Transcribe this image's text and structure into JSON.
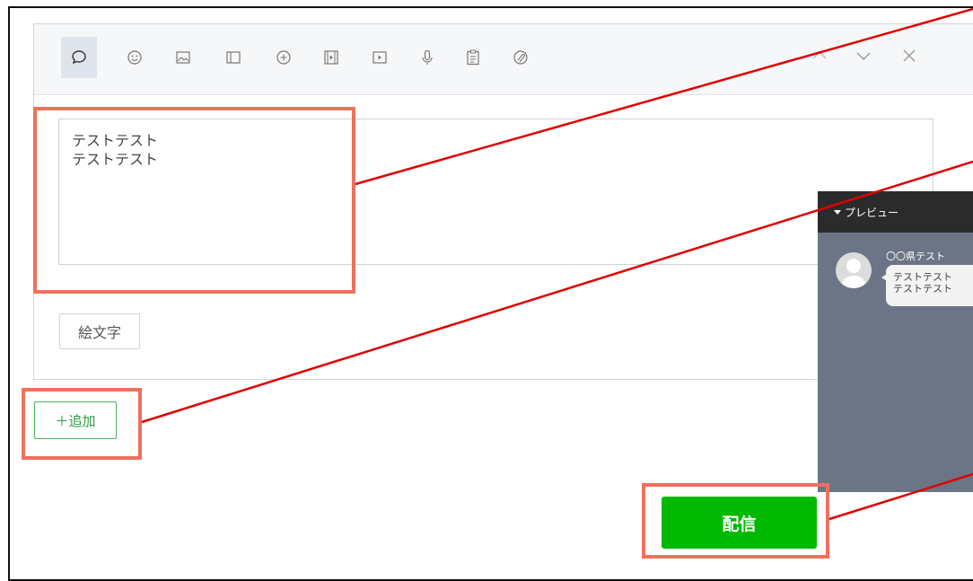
{
  "editor": {
    "message_text": "テストテスト\nテストテスト",
    "emoji_button_label": "絵文字"
  },
  "toolbar": {
    "icons": [
      "text-bubble-icon",
      "sticker-icon",
      "image-icon",
      "card-icon",
      "coupon-icon",
      "video-icon",
      "play-icon",
      "voice-icon",
      "survey-icon",
      "richmessage-icon"
    ],
    "active_tool": "text-bubble-icon"
  },
  "add_button": {
    "label": "＋追加"
  },
  "send_button": {
    "label": "配信"
  },
  "preview": {
    "title": "プレビュー",
    "sender_name": "〇〇県テスト",
    "bubble_text": "テストテスト\nテストテスト"
  },
  "colors": {
    "accent_green": "#00b900",
    "highlight_box": "#f0705f",
    "callout_line": "#e00000",
    "preview_bg": "#6b7585"
  }
}
